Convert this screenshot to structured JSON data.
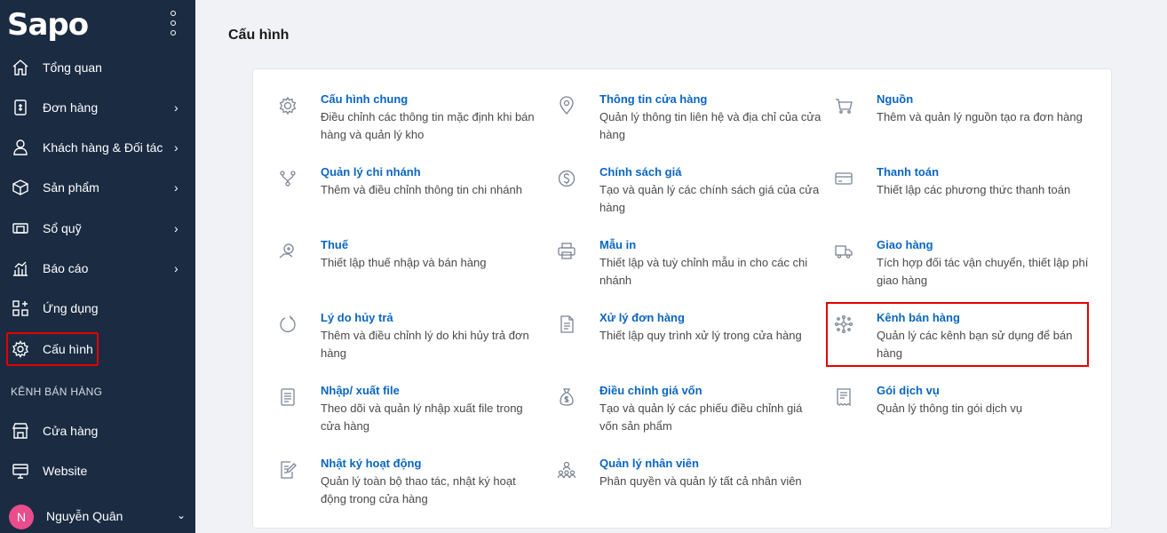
{
  "brand": {
    "name": "Sapo"
  },
  "sidebar": {
    "items": [
      {
        "label": "Tổng quan",
        "icon": "home-icon",
        "chevron": ""
      },
      {
        "label": "Đơn hàng",
        "icon": "orders-icon",
        "chevron": "›"
      },
      {
        "label": "Khách hàng & Đối tác",
        "icon": "user-icon",
        "chevron": "›"
      },
      {
        "label": "Sản phẩm",
        "icon": "box-icon",
        "chevron": "›"
      },
      {
        "label": "Sổ quỹ",
        "icon": "cashbook-icon",
        "chevron": "›"
      },
      {
        "label": "Báo cáo",
        "icon": "report-icon",
        "chevron": "›"
      },
      {
        "label": "Ứng dụng",
        "icon": "apps-icon",
        "chevron": ""
      },
      {
        "label": "Cấu hình",
        "icon": "gear-icon",
        "chevron": ""
      }
    ],
    "section_heading": "KÊNH BÁN HÀNG",
    "channels": [
      {
        "label": "Cửa hàng",
        "icon": "store-icon"
      },
      {
        "label": "Website",
        "icon": "website-icon"
      }
    ],
    "user": {
      "initial": "N",
      "name": "Nguyễn Quân",
      "caret": "⌄"
    }
  },
  "page": {
    "title": "Cấu hình"
  },
  "settings": [
    {
      "title": "Cấu hình chung",
      "desc": "Điều chỉnh các thông tin mặc định khi bán hàng và quản lý kho",
      "icon": "gear-icon"
    },
    {
      "title": "Thông tin cửa hàng",
      "desc": "Quản lý thông tin liên hệ và địa chỉ của cửa hàng",
      "icon": "location-pin-icon"
    },
    {
      "title": "Nguồn",
      "desc": "Thêm và quản lý nguồn tạo ra đơn hàng",
      "icon": "cart-icon"
    },
    {
      "title": "Quản lý chi nhánh",
      "desc": "Thêm và điều chỉnh thông tin chi nhánh",
      "icon": "branch-icon"
    },
    {
      "title": "Chính sách giá",
      "desc": "Tạo và quản lý các chính sách giá của cửa hàng",
      "icon": "dollar-icon"
    },
    {
      "title": "Thanh toán",
      "desc": "Thiết lập các phương thức thanh toán",
      "icon": "card-icon"
    },
    {
      "title": "Thuế",
      "desc": "Thiết lập thuế nhập và bán hàng",
      "icon": "tax-icon"
    },
    {
      "title": "Mẫu in",
      "desc": "Thiết lập và tuỳ chỉnh mẫu in cho các chi nhánh",
      "icon": "printer-icon"
    },
    {
      "title": "Giao hàng",
      "desc": "Tích hợp đối tác vận chuyển, thiết lập phí giao hàng",
      "icon": "truck-icon"
    },
    {
      "title": "Lý do hủy trả",
      "desc": "Thêm và điều chỉnh lý do khi hủy trả đơn hàng",
      "icon": "refresh-icon"
    },
    {
      "title": "Xử lý đơn hàng",
      "desc": "Thiết lập quy trình xử lý trong cửa hàng",
      "icon": "document-icon"
    },
    {
      "title": "Kênh bán hàng",
      "desc": "Quản lý các kênh bạn sử dụng để bán hàng",
      "icon": "network-icon"
    },
    {
      "title": "Nhập/ xuất file",
      "desc": "Theo dõi và quản lý nhập xuất file trong cửa hàng",
      "icon": "file-icon"
    },
    {
      "title": "Điều chỉnh giá vốn",
      "desc": "Tạo và quản lý các phiếu điều chỉnh giá vốn sản phẩm",
      "icon": "money-bag-icon"
    },
    {
      "title": "Gói dịch vụ",
      "desc": "Quản lý thông tin gói dịch vụ",
      "icon": "receipt-icon"
    },
    {
      "title": "Nhật ký hoạt động",
      "desc": "Quản lý toàn bộ thao tác, nhật ký hoạt động trong cửa hàng",
      "icon": "edit-log-icon"
    },
    {
      "title": "Quản lý nhân viên",
      "desc": "Phân quyền và quản lý tất cả nhân viên",
      "icon": "staff-icon"
    }
  ]
}
